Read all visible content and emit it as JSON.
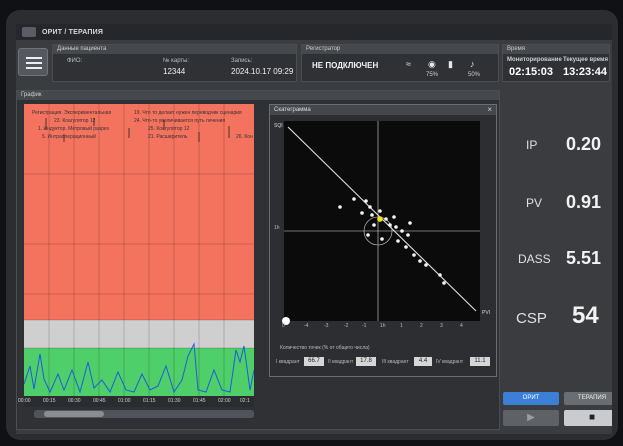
{
  "app": {
    "title": "ОРИТ / ТЕРАПИЯ"
  },
  "patient": {
    "header": "Данные пациента",
    "name_label": "ФИО:",
    "card_label": "№ карты:",
    "card_value": "12344",
    "record_label": "Запись:",
    "record_value": "2024.10.17 09:29"
  },
  "registrar": {
    "header": "Регистратор",
    "status": "НЕ ПОДКЛЮЧЕН",
    "battery1": "75%",
    "battery2": "50%"
  },
  "time": {
    "header": "Время",
    "monitoring_label": "Мониторирование",
    "monitoring_value": "02:15:03",
    "current_label": "Текущее время",
    "current_value": "13:23:44"
  },
  "graph": {
    "header": "График",
    "annotations": [
      "Регистрация. Экспериментальная",
      "19. Что то делает нужен переводчик сценария",
      "23. Коагулятор 12",
      "24. Что-то увеличивается путь лечения",
      "1. Индуктор. Метровый разрез",
      "25. Коагулятор 12",
      "5. Интраоперационный",
      "21. Расширитель",
      "26. Кон"
    ],
    "x_ticks": [
      "00:00",
      "00:15",
      "00:30",
      "00:45",
      "01:00",
      "01:15",
      "01:30",
      "01:45",
      "02:00",
      "02:1"
    ]
  },
  "scatter": {
    "header": "Скатеграмма",
    "x_label": "PVI",
    "y_label": "SQI",
    "x_ticks": [
      "0",
      "-4",
      "-3",
      "-2",
      "-1",
      "1h",
      "1",
      "2",
      "3",
      "4"
    ],
    "y_ticks": [
      "1h"
    ],
    "footer": "Количество точек (% от общего числа)",
    "quadrants": [
      {
        "label": "I квадрант",
        "value": "66.7"
      },
      {
        "label": "II квадрант",
        "value": "17.8"
      },
      {
        "label": "III квадрант",
        "value": "4.4"
      },
      {
        "label": "IV квадрант",
        "value": "11.1"
      }
    ]
  },
  "metrics": [
    {
      "label": "IP",
      "value": "0.20"
    },
    {
      "label": "PV",
      "value": "0.91"
    },
    {
      "label": "DASS",
      "value": "5.51"
    },
    {
      "label": "CSP",
      "value": "54"
    }
  ],
  "buttons": {
    "orit": "ОРИТ",
    "therapy": "ТЕРАПИЯ"
  },
  "colors": {
    "zone_red": "#f4735e",
    "zone_gray": "#cfcfcf",
    "zone_green": "#4fcf6a",
    "signal": "#1e5be0",
    "accent": "#3b7fd6"
  }
}
